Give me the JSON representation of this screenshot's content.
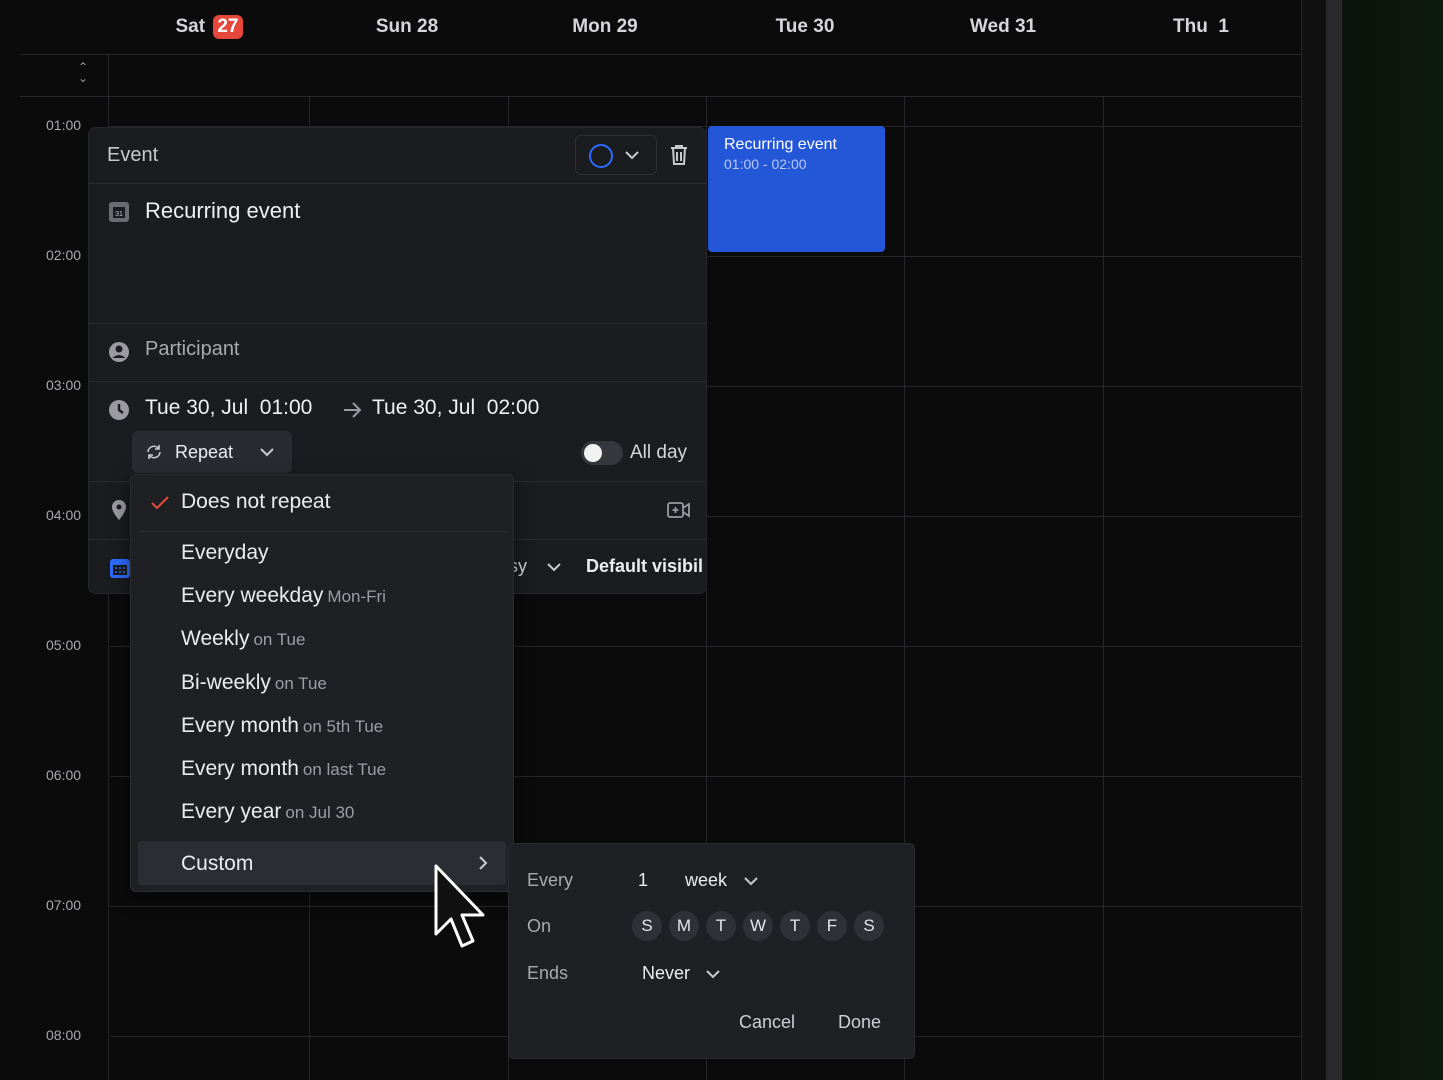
{
  "calendar": {
    "days": [
      {
        "name": "Sat",
        "num": "27",
        "today": true
      },
      {
        "name": "Sun",
        "num": "28"
      },
      {
        "name": "Mon",
        "num": "29"
      },
      {
        "name": "Tue",
        "num": "30"
      },
      {
        "name": "Wed",
        "num": "31"
      },
      {
        "name": "Thu",
        "num": " 1"
      }
    ],
    "times": [
      "01:00",
      "02:00",
      "03:00",
      "04:00",
      "05:00",
      "06:00",
      "07:00",
      "08:00"
    ],
    "event": {
      "title": "Recurring event",
      "time": "01:00 - 02:00",
      "color": "#2457d8"
    }
  },
  "event_panel": {
    "header": "Event",
    "accent_color": "#2d6bff",
    "title": "Recurring event",
    "participant_placeholder": "Participant",
    "start": "Tue 30, Jul  01:00",
    "end": "Tue 30, Jul  02:00",
    "repeat_label": "Repeat",
    "all_day_label": "All day",
    "all_day_on": false,
    "busy_fragment": "sy",
    "visibility_fragment": "Default visibil"
  },
  "repeat_menu": {
    "selected": "Does not repeat",
    "options": [
      {
        "label": "Everyday",
        "hint": ""
      },
      {
        "label": "Every weekday",
        "hint": "Mon-Fri"
      },
      {
        "label": "Weekly",
        "hint": "on Tue"
      },
      {
        "label": "Bi-weekly",
        "hint": "on Tue"
      },
      {
        "label": "Every month",
        "hint": "on 5th Tue"
      },
      {
        "label": "Every month",
        "hint": "on last Tue"
      },
      {
        "label": "Every year",
        "hint": "on Jul 30"
      }
    ],
    "custom_label": "Custom"
  },
  "custom_repeat": {
    "every_label": "Every",
    "every_value": "1",
    "unit": "week",
    "on_label": "On",
    "weekdays": [
      "S",
      "M",
      "T",
      "W",
      "T",
      "F",
      "S"
    ],
    "ends_label": "Ends",
    "ends_value": "Never",
    "cancel": "Cancel",
    "done": "Done"
  }
}
